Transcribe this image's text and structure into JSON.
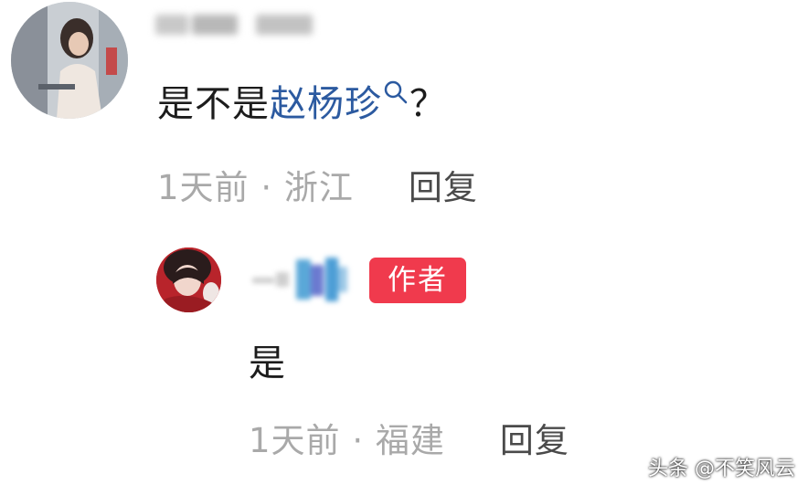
{
  "main_comment": {
    "text_before": "是不是",
    "keyword": "赵杨珍",
    "text_after": "？",
    "time": "1天前",
    "separator": "·",
    "location": "浙江",
    "reply_label": "回复"
  },
  "reply_comment": {
    "badge": "作者",
    "text": "是",
    "time": "1天前",
    "separator": "·",
    "location": "福建",
    "reply_label": "回复"
  },
  "watermark": "头条 @不笑风云",
  "colors": {
    "keyword": "#2c5aa0",
    "meta": "#a9a9a9",
    "badge_bg": "#f03a4d",
    "text": "#1c1c1c"
  },
  "icons": {
    "keyword_search": "search-icon"
  }
}
